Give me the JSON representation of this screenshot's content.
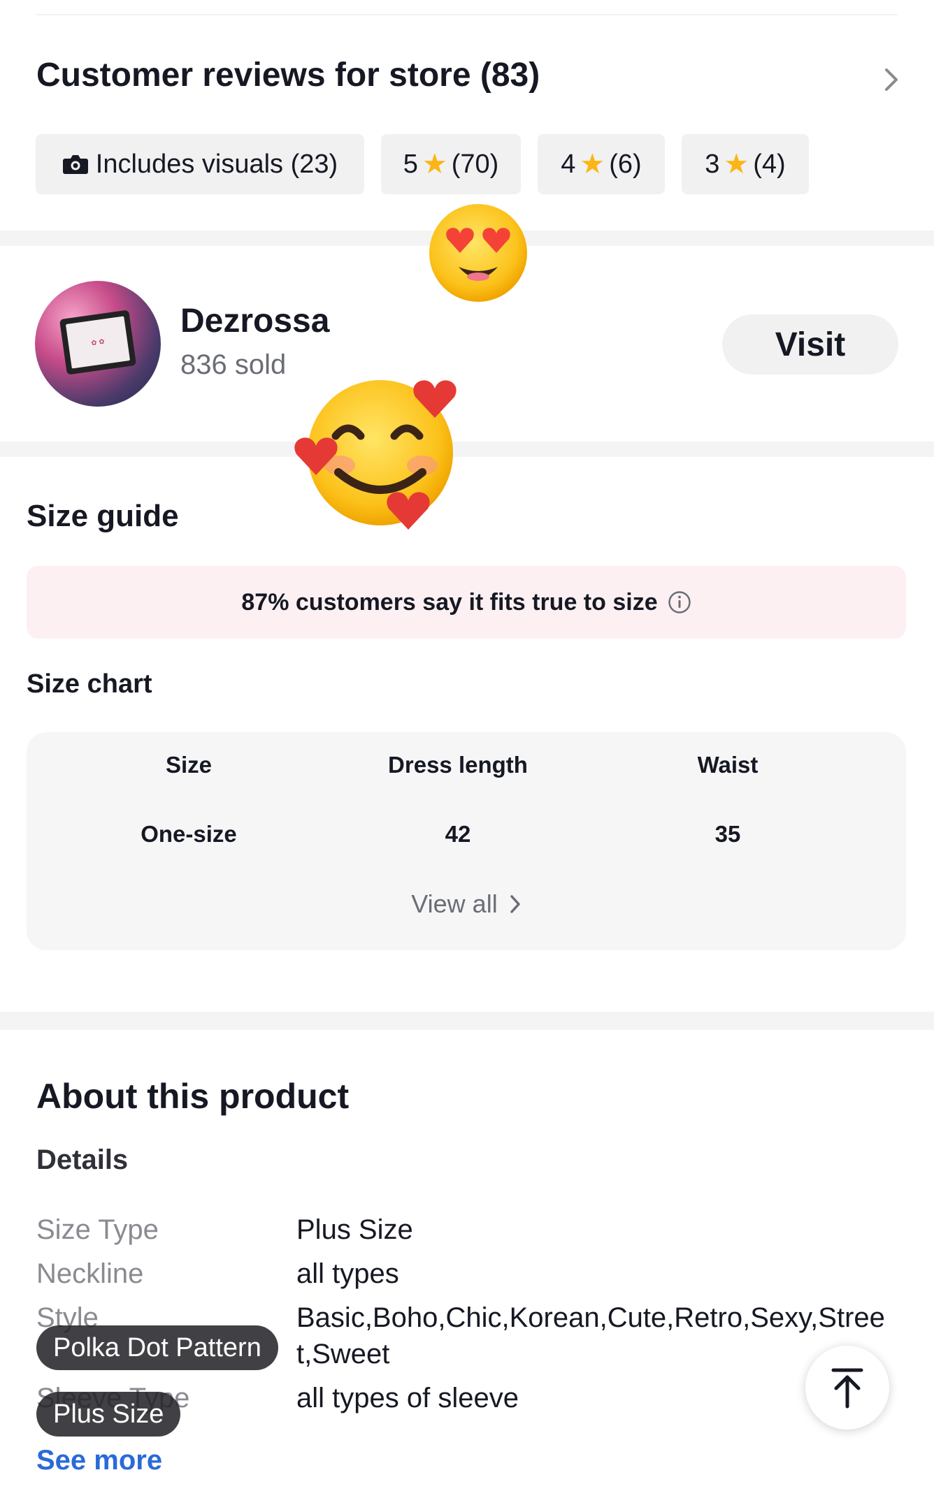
{
  "reviews": {
    "title": "Customer reviews for store (83)",
    "chips": [
      {
        "label": "Includes visuals (23)",
        "icon": "camera-icon"
      },
      {
        "label_num": "5",
        "label_count": "(70)",
        "icon": "star-icon"
      },
      {
        "label_num": "4",
        "label_count": "(6)",
        "icon": "star-icon"
      },
      {
        "label_num": "3",
        "label_count": "(4)",
        "icon": "star-icon"
      }
    ],
    "star_color": "#fbb514"
  },
  "store": {
    "name": "Dezrossa",
    "sold": "836 sold",
    "visit_label": "Visit"
  },
  "size_guide": {
    "title": "Size guide",
    "fit_text": "87% customers say it fits true to size",
    "chart_title": "Size chart",
    "columns": [
      "Size",
      "Dress length",
      "Waist"
    ],
    "rows": [
      [
        "One-size",
        "42",
        "35"
      ]
    ],
    "view_all": "View all"
  },
  "about": {
    "title": "About this product",
    "details_title": "Details",
    "specs": [
      {
        "key": "Size Type",
        "value": "Plus Size"
      },
      {
        "key": "Neckline",
        "value": "all types"
      },
      {
        "key": "Style",
        "value": "Basic,Boho,Chic,Korean,Cute,Retro,Sexy,Street,Sweet"
      },
      {
        "key": "Sleeve Type",
        "value": "all types of sleeve"
      }
    ],
    "see_more": "See more"
  },
  "overlay_tags": [
    "Polka Dot Pattern",
    "Plus Size"
  ],
  "colors": {
    "link": "#2a6ad8",
    "fit_banner_bg": "#fdf0f2"
  }
}
